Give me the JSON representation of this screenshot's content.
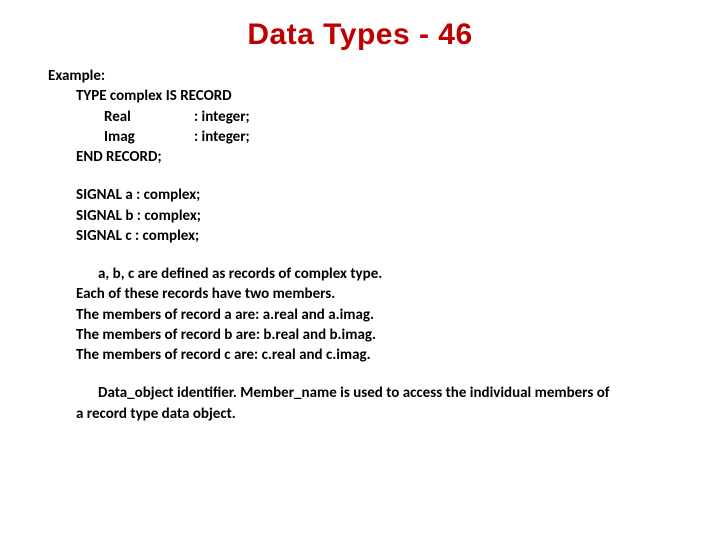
{
  "title": "Data Types - 46",
  "exampleLabel": "Example:",
  "type": {
    "line1": "TYPE  complex IS RECORD",
    "fields": [
      {
        "name": "Real",
        "type": ": integer;"
      },
      {
        "name": "Imag",
        "type": ": integer;"
      }
    ],
    "end": "END RECORD;"
  },
  "signals": [
    "SIGNAL a : complex;",
    "SIGNAL b : complex;",
    "SIGNAL c : complex;"
  ],
  "desc": [
    "a,  b, c are defined as records of complex type.",
    "Each of these records have two members.",
    "The members of record a are: a.real and a.imag.",
    "The members of record b are: b.real and b.imag.",
    "The members of record c are: c.real and c.imag."
  ],
  "note": [
    "Data_object identifier. Member_name is used to access the individual members of",
    "a           record type data object."
  ]
}
